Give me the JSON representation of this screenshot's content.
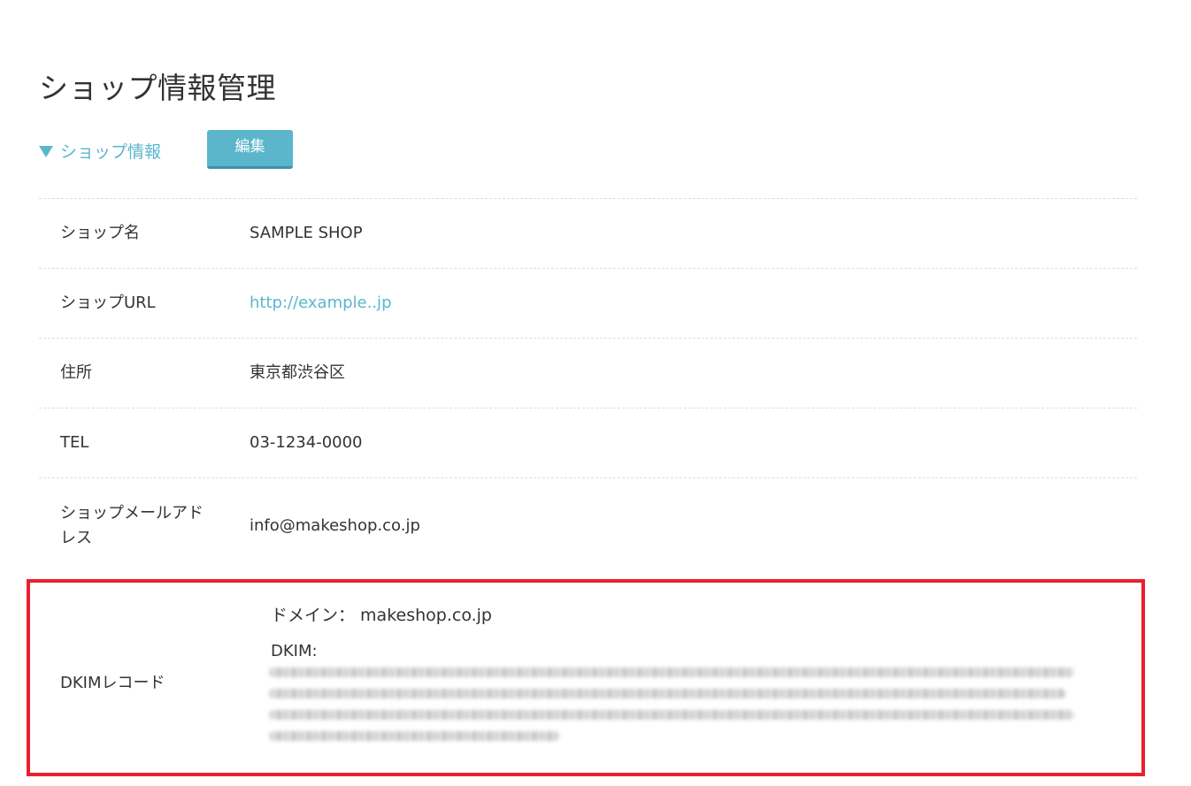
{
  "page": {
    "title": "ショップ情報管理"
  },
  "section": {
    "toggle_label": "ショップ情報",
    "edit_button_label": "編集"
  },
  "rows": [
    {
      "label": "ショップ名",
      "value": "SAMPLE SHOP"
    },
    {
      "label": "ショップURL",
      "value": "http://example..jp"
    },
    {
      "label": "住所",
      "value": "東京都渋谷区"
    },
    {
      "label": "TEL",
      "value": "03-1234-0000"
    },
    {
      "label": "ショップメールアドレス",
      "value": "info@makeshop.co.jp"
    }
  ],
  "dkim": {
    "label": "DKIMレコード",
    "domain_line": "ドメイン： makeshop.co.jp",
    "dkim_title": "DKIM:"
  },
  "colors": {
    "accent": "#5bb6cc",
    "highlight_border": "#e8202f",
    "text": "#333333"
  }
}
